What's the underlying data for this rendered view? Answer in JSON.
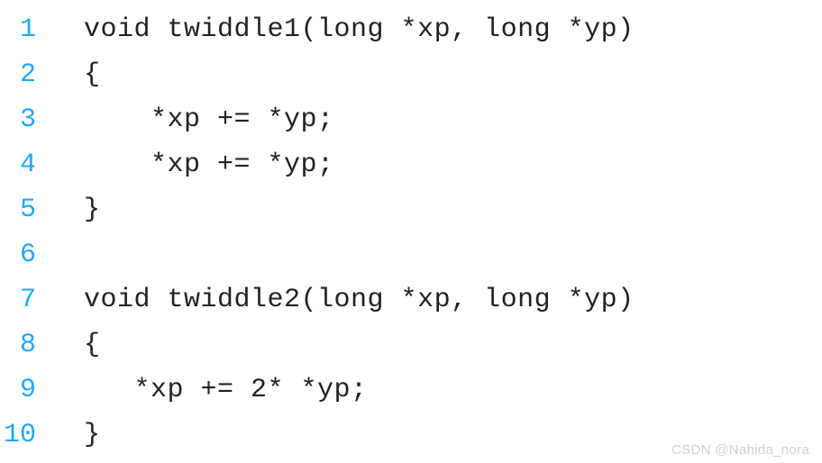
{
  "code": {
    "lines": [
      {
        "n": "1",
        "text": "  void twiddle1(long *xp, long *yp)"
      },
      {
        "n": "2",
        "text": "  {"
      },
      {
        "n": "3",
        "text": "      *xp += *yp;"
      },
      {
        "n": "4",
        "text": "      *xp += *yp;"
      },
      {
        "n": "5",
        "text": "  }"
      },
      {
        "n": "6",
        "text": ""
      },
      {
        "n": "7",
        "text": "  void twiddle2(long *xp, long *yp)"
      },
      {
        "n": "8",
        "text": "  {"
      },
      {
        "n": "9",
        "text": "     *xp += 2* *yp;"
      },
      {
        "n": "10",
        "text": "  }"
      }
    ]
  },
  "watermark": "CSDN @Nahida_nora",
  "colors": {
    "line_number": "#1ea8ff",
    "code_text": "#222222",
    "background": "#ffffff"
  }
}
